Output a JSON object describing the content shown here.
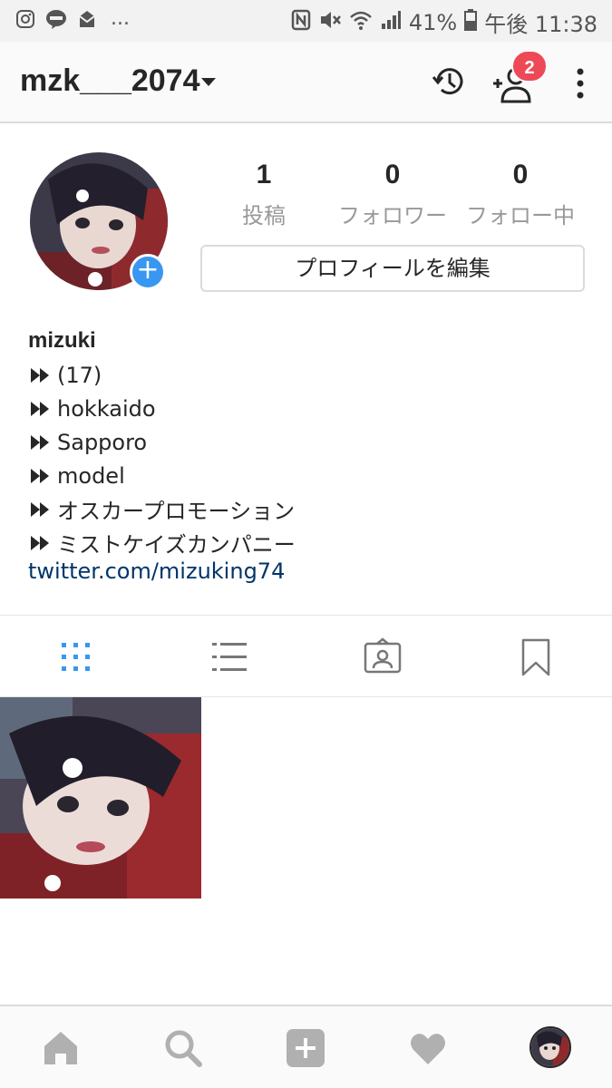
{
  "status_bar": {
    "overflow_indicator": "...",
    "battery": "41%",
    "time": "午後 11:38",
    "left_icons": [
      "instagram-icon",
      "line-icon",
      "mail-icon"
    ],
    "right_icons": [
      "nfc-icon",
      "mute-icon",
      "wifi-icon",
      "signal-icon",
      "battery-icon"
    ]
  },
  "header": {
    "username": "mzk___2074",
    "notification_count": "2"
  },
  "profile": {
    "stats": [
      {
        "value": "1",
        "label": "投稿"
      },
      {
        "value": "0",
        "label": "フォロワー"
      },
      {
        "value": "0",
        "label": "フォロー中"
      }
    ],
    "edit_button": "プロフィールを編集",
    "display_name": "mizuki",
    "bio_lines": [
      "(17)",
      "hokkaido",
      "Sapporo",
      "model",
      "オスカープロモーション",
      "ミストケイズカンパニー"
    ],
    "link": "twitter.com/mizuking74"
  },
  "tabs": [
    "grid",
    "list",
    "tagged",
    "saved"
  ],
  "posts_count_shown": 1,
  "colors": {
    "accent_blue": "#3897f0",
    "badge_red": "#ed4956",
    "link_blue": "#003569",
    "text_dark": "#262626",
    "text_gray": "#999999"
  }
}
